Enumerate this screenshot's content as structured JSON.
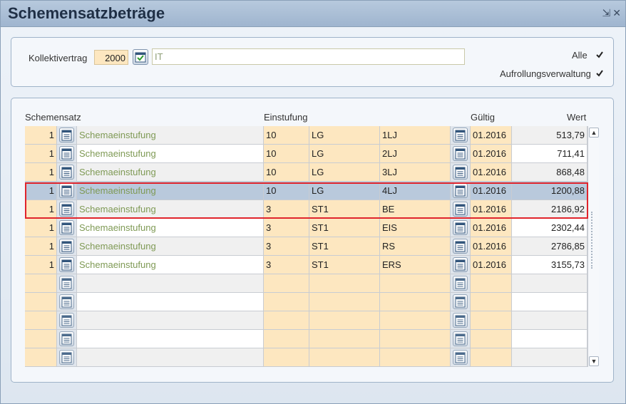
{
  "window": {
    "title": "Schemensatzbeträge"
  },
  "filter": {
    "kollektiv_label": "Kollektivertrag",
    "kollektiv_value": "2000",
    "kollektiv_text": "IT",
    "alle_label": "Alle",
    "alle_checked": true,
    "aufrollung_label": "Aufrollungsverwaltung",
    "aufrollung_checked": true
  },
  "grid": {
    "headers": {
      "schemensatz": "Schemensatz",
      "einstufung": "Einstufung",
      "gueltig": "Gültig",
      "wert": "Wert"
    },
    "rows": [
      {
        "num": "1",
        "name": "Schemaeinstufung",
        "e1": "10",
        "e2": "LG",
        "e3": "1LJ",
        "date": "01.2016",
        "wert": "513,79"
      },
      {
        "num": "1",
        "name": "Schemaeinstufung",
        "e1": "10",
        "e2": "LG",
        "e3": "2LJ",
        "date": "01.2016",
        "wert": "711,41"
      },
      {
        "num": "1",
        "name": "Schemaeinstufung",
        "e1": "10",
        "e2": "LG",
        "e3": "3LJ",
        "date": "01.2016",
        "wert": "868,48"
      },
      {
        "num": "1",
        "name": "Schemaeinstufung",
        "e1": "10",
        "e2": "LG",
        "e3": "4LJ",
        "date": "01.2016",
        "wert": "1200,88"
      },
      {
        "num": "1",
        "name": "Schemaeinstufung",
        "e1": "3",
        "e2": "ST1",
        "e3": "BE",
        "date": "01.2016",
        "wert": "2186,92"
      },
      {
        "num": "1",
        "name": "Schemaeinstufung",
        "e1": "3",
        "e2": "ST1",
        "e3": "EIS",
        "date": "01.2016",
        "wert": "2302,44"
      },
      {
        "num": "1",
        "name": "Schemaeinstufung",
        "e1": "3",
        "e2": "ST1",
        "e3": "RS",
        "date": "01.2016",
        "wert": "2786,85"
      },
      {
        "num": "1",
        "name": "Schemaeinstufung",
        "e1": "3",
        "e2": "ST1",
        "e3": "ERS",
        "date": "01.2016",
        "wert": "3155,73"
      }
    ],
    "empty_rows": 5,
    "selected_row": 3
  },
  "colors": {
    "accent_highlight": "#e0242c",
    "selection": "#b9c9dc",
    "input_bg": "#fde7c0"
  },
  "icons": {
    "picker": "calendar-list-icon",
    "confirm": "check-icon",
    "minimize": "minimize-icon",
    "close": "close-icon"
  }
}
